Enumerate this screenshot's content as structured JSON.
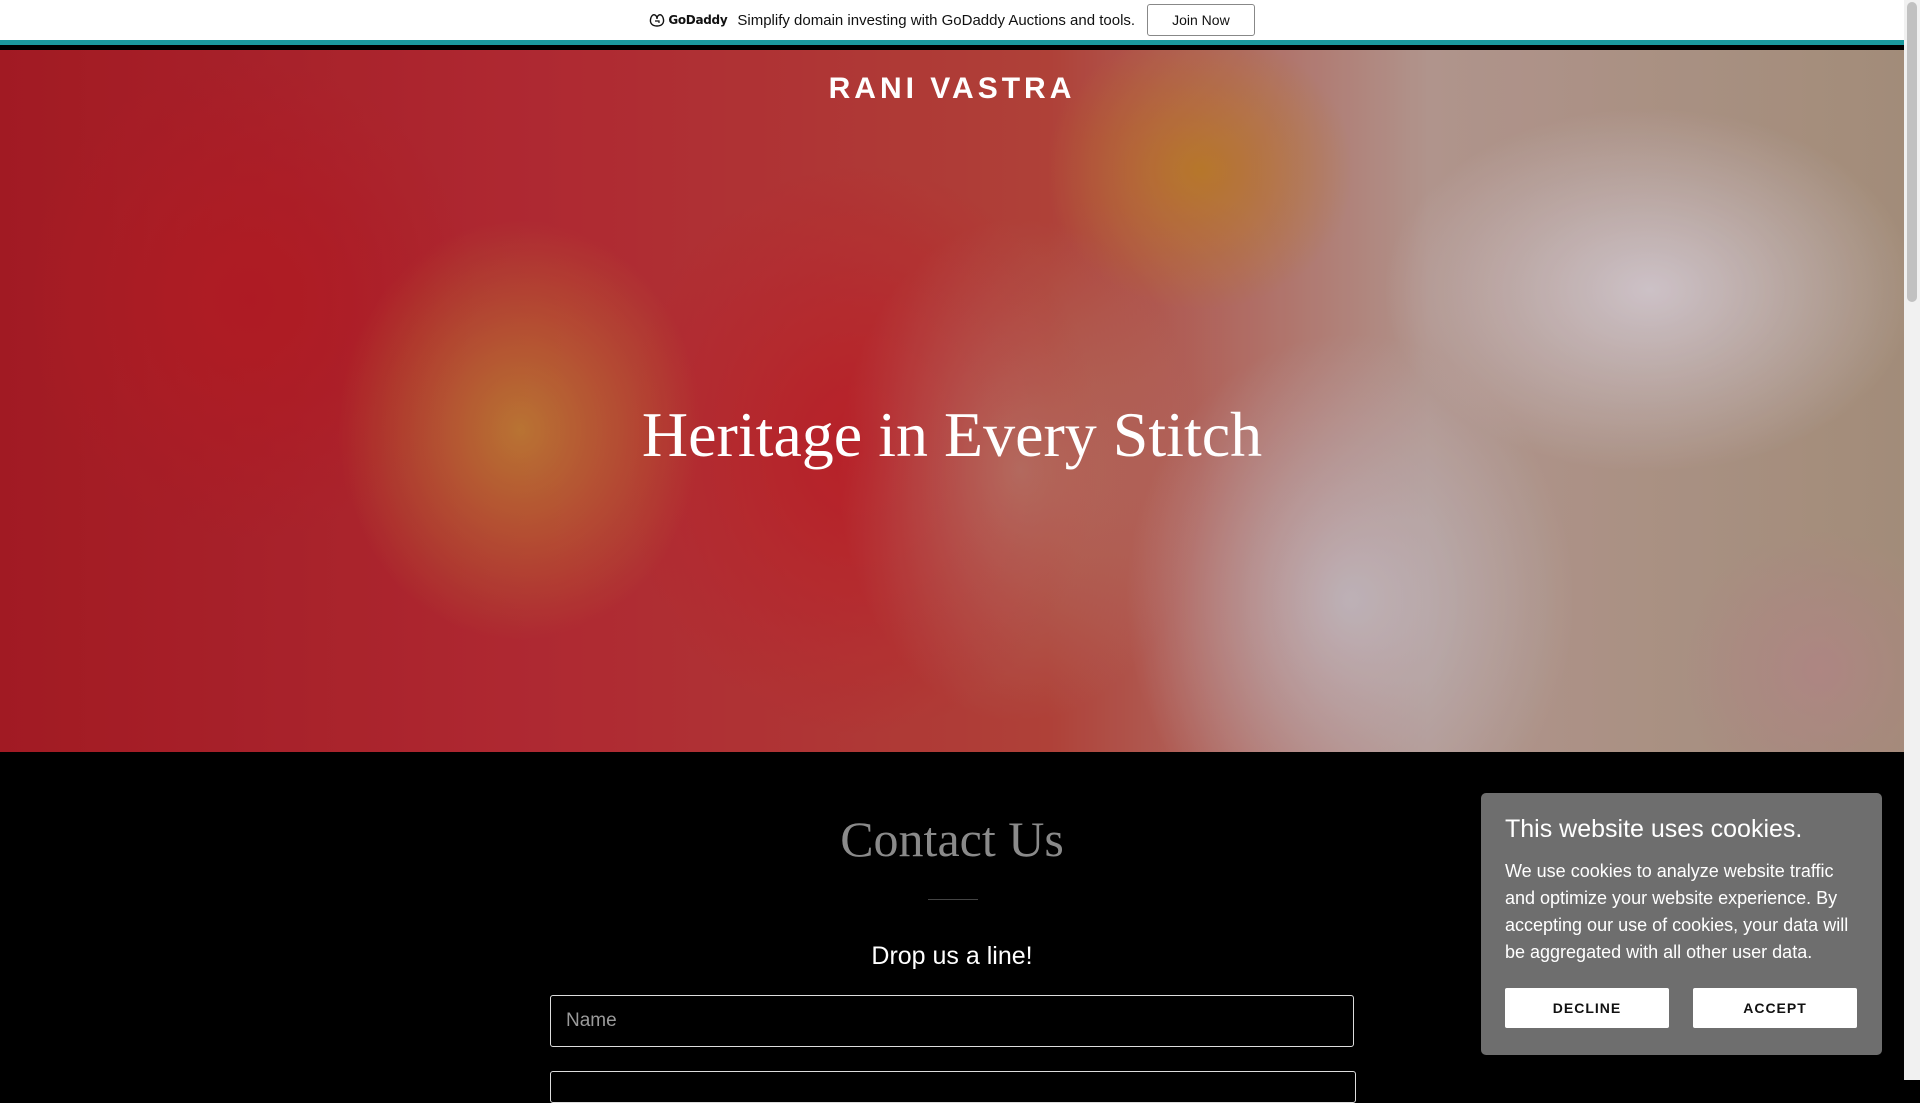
{
  "banner": {
    "logo_text": "GoDaddy",
    "message": "Simplify domain investing with GoDaddy Auctions and tools.",
    "join_label": "Join Now",
    "accent_color": "#1b9a9e"
  },
  "hero": {
    "brand": "RANI VASTRA",
    "headline": "Heritage in Every Stitch"
  },
  "contact": {
    "title": "Contact Us",
    "subtitle": "Drop us a line!",
    "name_placeholder": "Name"
  },
  "cookie": {
    "title": "This website uses cookies.",
    "body": "We use cookies to analyze website traffic and optimize your website experience. By accepting our use of cookies, your data will be aggregated with all other user data.",
    "decline_label": "DECLINE",
    "accept_label": "ACCEPT"
  }
}
